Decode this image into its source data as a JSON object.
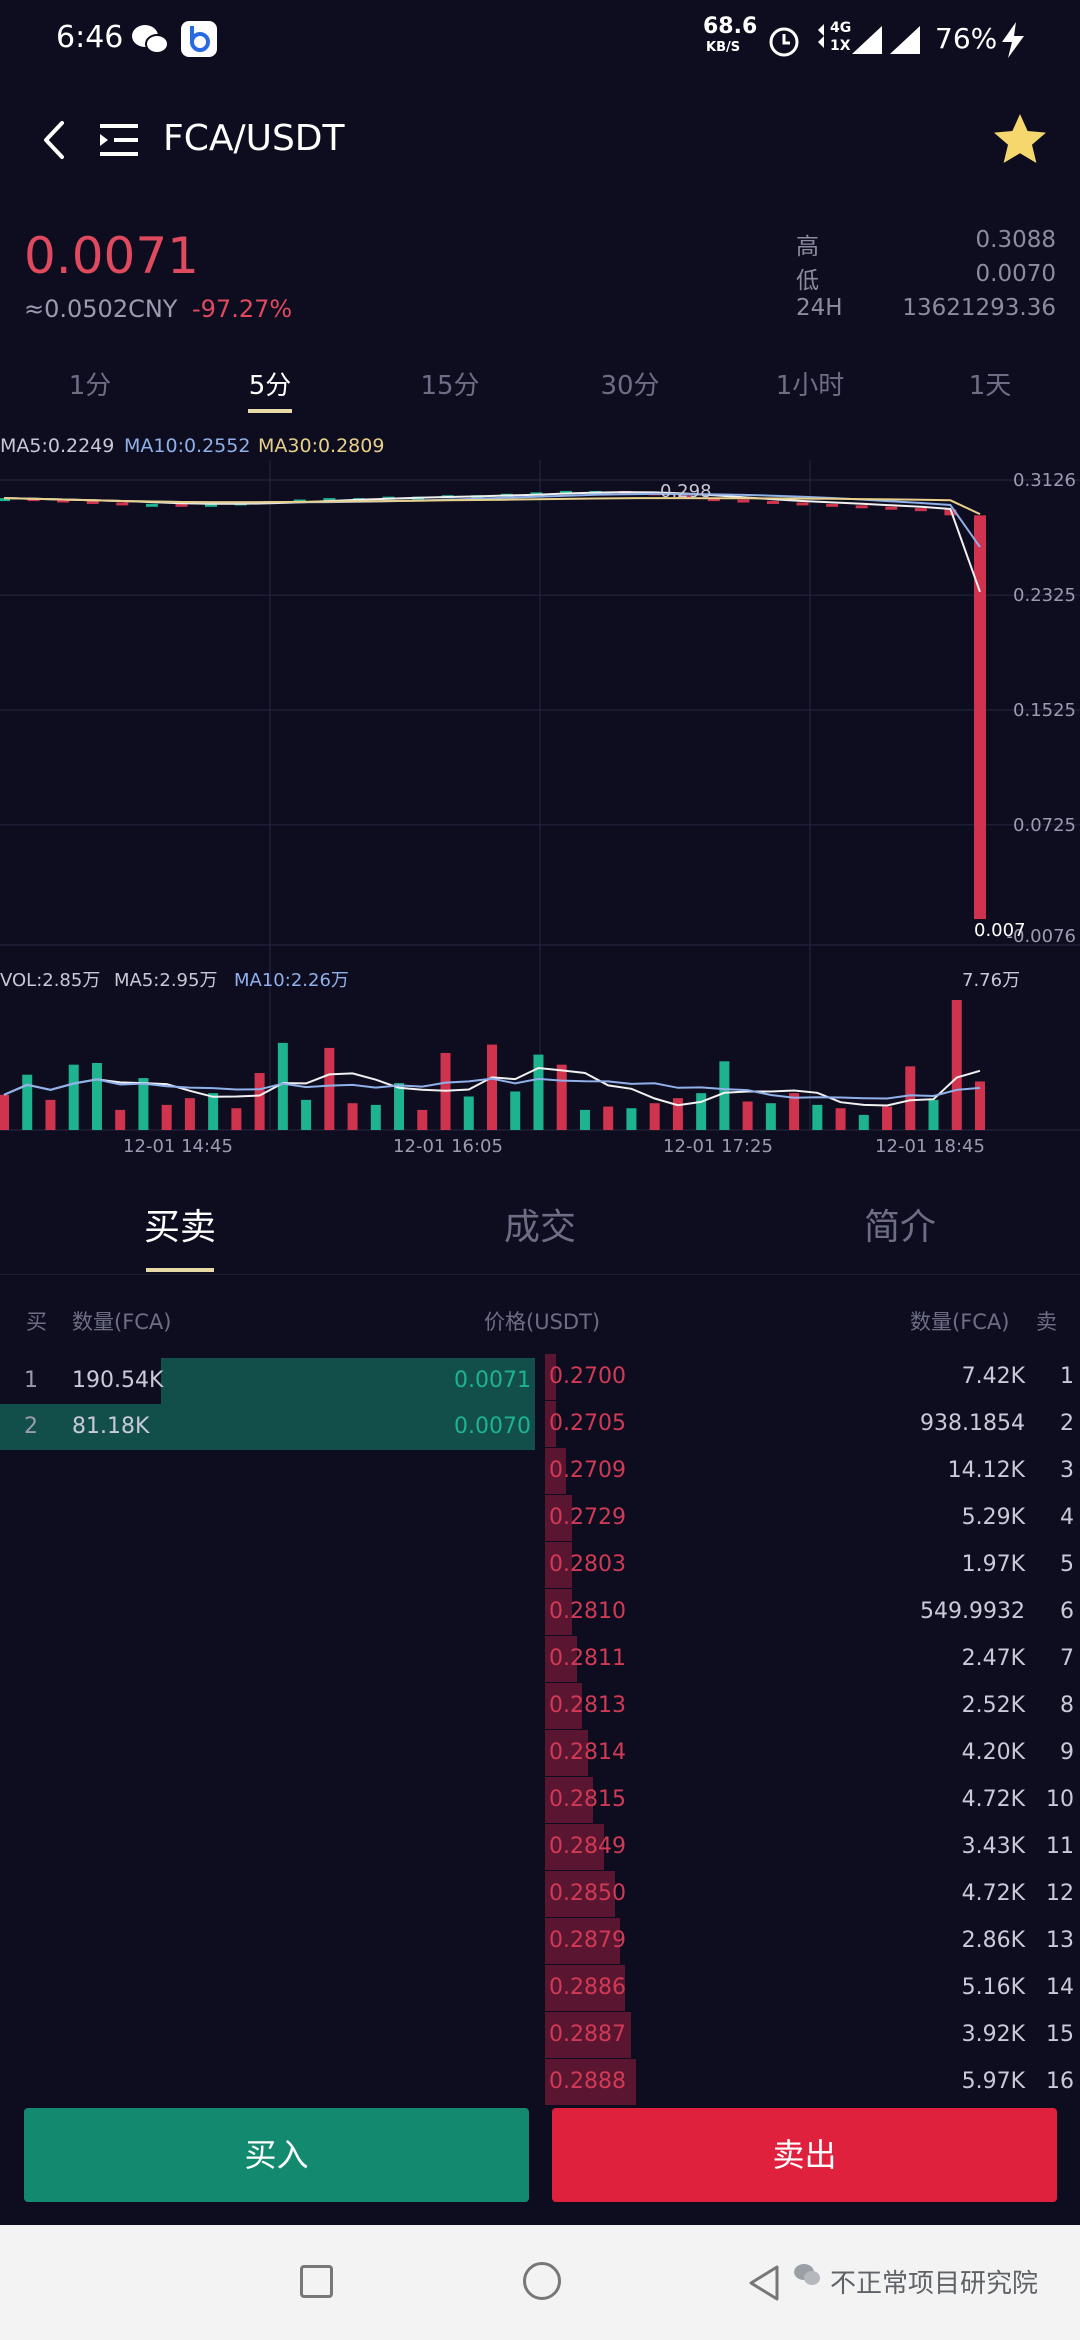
{
  "status_bar": {
    "time": "6:46",
    "net_speed": "68.6",
    "net_unit": "KB/S",
    "network": "4G",
    "network_sub": "1X",
    "battery": "76%",
    "icons": [
      "wechat-icon",
      "app-b-icon",
      "alarm-icon",
      "signal-icon",
      "battery-charging-icon"
    ]
  },
  "header": {
    "pair": "FCA/USDT",
    "icons": [
      "back-icon",
      "menu-icon",
      "star-icon"
    ],
    "star_color": "#f5d76e"
  },
  "ticker": {
    "last_price": "0.0071",
    "cny": "≈0.0502CNY",
    "change": "-97.27%",
    "high_label": "高",
    "high": "0.3088",
    "low_label": "低",
    "low": "0.0070",
    "vol_label": "24H",
    "vol": "13621293.36"
  },
  "intervals": [
    "1分",
    "5分",
    "15分",
    "30分",
    "1小时",
    "1天"
  ],
  "interval_active": "5分",
  "indicators": {
    "ma5": "MA5:0.2249",
    "ma10": "MA10:0.2552",
    "ma30": "MA30:0.2809",
    "vol": "VOL:2.85万",
    "vol_ma5": "MA5:2.95万",
    "vol_ma10": "MA10:2.26万"
  },
  "chart_data": {
    "type": "candlestick",
    "price_ticks": [
      "0.3126",
      "0.2325",
      "0.1525",
      "0.0725",
      "-0.0076"
    ],
    "y_range": [
      -0.0076,
      0.3126
    ],
    "price_label_high": "0.298",
    "price_label_low": "0.007",
    "vol_max_label": "7.76万",
    "x_ticks": [
      "12-01 14:45",
      "12-01 16:05",
      "12-01 17:25",
      "12-01 18:45"
    ],
    "close_series": [
      0.3,
      0.299,
      0.298,
      0.297,
      0.296,
      0.296,
      0.295,
      0.296,
      0.297,
      0.298,
      0.299,
      0.3,
      0.3,
      0.301,
      0.301,
      0.302,
      0.302,
      0.303,
      0.304,
      0.305,
      0.305,
      0.304,
      0.302,
      0.3,
      0.299,
      0.298,
      0.297,
      0.296,
      0.295,
      0.294,
      0.293,
      0.292,
      0.288,
      0.007
    ],
    "volumes_wan": [
      2.1,
      3.3,
      1.8,
      3.9,
      4.0,
      1.2,
      3.1,
      1.5,
      1.9,
      2.2,
      1.3,
      3.4,
      5.2,
      1.8,
      4.9,
      1.6,
      1.5,
      2.8,
      1.2,
      4.6,
      2.0,
      5.1,
      2.3,
      4.5,
      3.9,
      1.2,
      1.4,
      1.3,
      1.6,
      1.9,
      2.2,
      4.1,
      1.7,
      1.6,
      2.2,
      1.5,
      1.3,
      0.9,
      1.4,
      3.8,
      1.8,
      7.76,
      2.9
    ],
    "volume_up": [
      false,
      true,
      false,
      true,
      true,
      false,
      true,
      false,
      false,
      true,
      false,
      false,
      true,
      true,
      false,
      false,
      true,
      true,
      false,
      false,
      true,
      false,
      true,
      true,
      false,
      true,
      false,
      true,
      false,
      false,
      true,
      true,
      false,
      true,
      false,
      true,
      false,
      true,
      false,
      false,
      true,
      false,
      false
    ],
    "colors": {
      "up": "#1eb38f",
      "down": "#d0334e",
      "ma5": "#f0f0f0",
      "ma10": "#8fb0e8",
      "ma30": "#e8d08a"
    }
  },
  "section_tabs": [
    "买卖",
    "成交",
    "简介"
  ],
  "section_active": "买卖",
  "orderbook": {
    "header": {
      "buy": "买",
      "buy_qty": "数量(FCA)",
      "price": "价格(USDT)",
      "sell_qty": "数量(FCA)",
      "sell": "卖"
    },
    "bids": [
      {
        "idx": "1",
        "qty": "190.54K",
        "price": "0.0071",
        "depth": 0.7
      },
      {
        "idx": "2",
        "qty": "81.18K",
        "price": "0.0070",
        "depth": 1.0
      }
    ],
    "asks": [
      {
        "idx": "1",
        "price": "0.2700",
        "qty": "7.42K",
        "depth": 0.02
      },
      {
        "idx": "2",
        "price": "0.2705",
        "qty": "938.1854",
        "depth": 0.02
      },
      {
        "idx": "3",
        "price": "0.2709",
        "qty": "14.12K",
        "depth": 0.04
      },
      {
        "idx": "4",
        "price": "0.2729",
        "qty": "5.29K",
        "depth": 0.05
      },
      {
        "idx": "5",
        "price": "0.2803",
        "qty": "1.97K",
        "depth": 0.05
      },
      {
        "idx": "6",
        "price": "0.2810",
        "qty": "549.9932",
        "depth": 0.05
      },
      {
        "idx": "7",
        "price": "0.2811",
        "qty": "2.47K",
        "depth": 0.06
      },
      {
        "idx": "8",
        "price": "0.2813",
        "qty": "2.52K",
        "depth": 0.07
      },
      {
        "idx": "9",
        "price": "0.2814",
        "qty": "4.20K",
        "depth": 0.08
      },
      {
        "idx": "10",
        "price": "0.2815",
        "qty": "4.72K",
        "depth": 0.09
      },
      {
        "idx": "11",
        "price": "0.2849",
        "qty": "3.43K",
        "depth": 0.11
      },
      {
        "idx": "12",
        "price": "0.2850",
        "qty": "4.72K",
        "depth": 0.13
      },
      {
        "idx": "13",
        "price": "0.2879",
        "qty": "2.86K",
        "depth": 0.14
      },
      {
        "idx": "14",
        "price": "0.2886",
        "qty": "5.16K",
        "depth": 0.15
      },
      {
        "idx": "15",
        "price": "0.2887",
        "qty": "3.92K",
        "depth": 0.16
      },
      {
        "idx": "16",
        "price": "0.2888",
        "qty": "5.97K",
        "depth": 0.17
      }
    ]
  },
  "actions": {
    "buy": "买入",
    "sell": "卖出"
  },
  "watermark": "不正常项目研究院"
}
